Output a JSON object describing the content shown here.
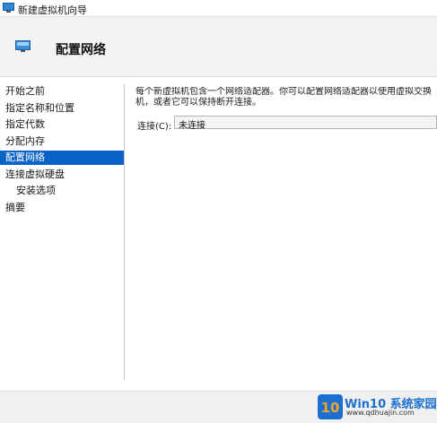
{
  "window": {
    "title": "新建虚拟机向导"
  },
  "header": {
    "title": "配置网络"
  },
  "nav": {
    "items": [
      {
        "label": "开始之前"
      },
      {
        "label": "指定名称和位置"
      },
      {
        "label": "指定代数"
      },
      {
        "label": "分配内存"
      },
      {
        "label": "配置网络",
        "selected": true
      },
      {
        "label": "连接虚拟硬盘"
      },
      {
        "label": "安装选项"
      },
      {
        "label": "摘要"
      }
    ]
  },
  "main": {
    "description": "每个新虚拟机包含一个网络适配器。你可以配置网络适配器以使用虚拟交换机，或者它可以保持断开连接。",
    "connection": {
      "label": "连接(C):",
      "value": "未连接"
    }
  },
  "watermark": {
    "logo_text": "10",
    "brand": "Win10 系统家园",
    "site": "www.qdhuajin.com"
  },
  "colors": {
    "selection": "#0a64c8",
    "header_bg": "#f3f3f3",
    "brand": "#1b6fd1"
  },
  "icons": {
    "app": "monitor-icon",
    "wizard": "monitor-icon",
    "watermark": "win10-logo-icon"
  }
}
